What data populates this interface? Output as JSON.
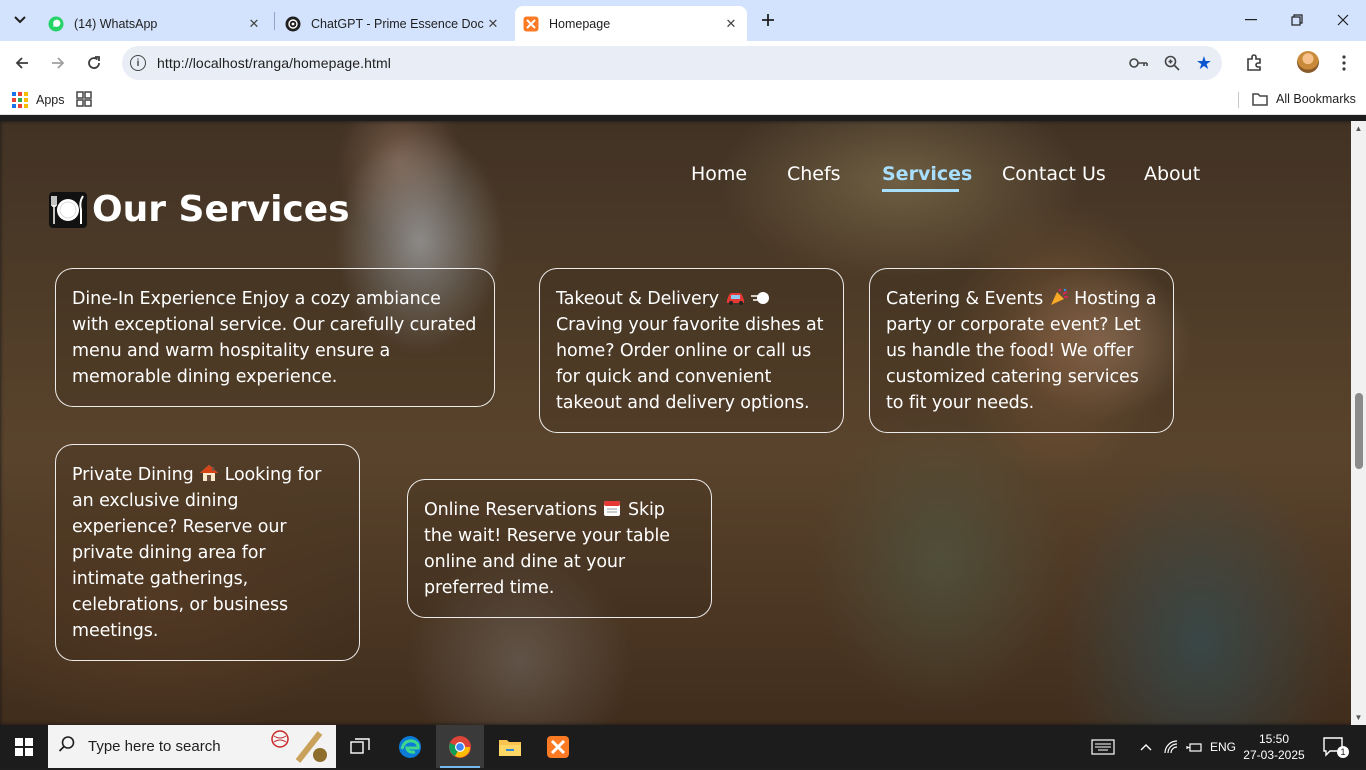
{
  "browser": {
    "tabs": [
      {
        "title": "(14) WhatsApp",
        "icon": "whatsapp-icon",
        "active": false
      },
      {
        "title": "ChatGPT - Prime Essence Doc",
        "icon": "chatgpt-icon",
        "active": false
      },
      {
        "title": "Homepage",
        "icon": "xampp-icon",
        "active": true
      }
    ],
    "url": "http://localhost/ranga/homepage.html",
    "bookmarks": {
      "apps_label": "Apps",
      "all_bookmarks_label": "All Bookmarks"
    }
  },
  "page": {
    "nav": [
      {
        "label": "Home",
        "active": false
      },
      {
        "label": "Chefs",
        "active": false
      },
      {
        "label": "Services",
        "active": true
      },
      {
        "label": "Contact Us",
        "active": false
      },
      {
        "label": "About",
        "active": false
      }
    ],
    "section_title": "Our Services",
    "services": [
      {
        "text": "Dine-In Experience Enjoy a cozy ambiance with exceptional service. Our carefully curated menu and warm hospitality ensure a memorable dining experience."
      },
      {
        "title": "Takeout & Delivery",
        "emoji": "car-icon",
        "text": "Craving your favorite dishes at home? Order online or call us for quick and convenient takeout and delivery options."
      },
      {
        "title": "Catering & Events",
        "emoji": "party-popper-icon",
        "text": "Hosting a party or corporate event? Let us handle the food! We offer customized catering services to fit your needs."
      },
      {
        "title": "Private Dining",
        "emoji": "house-icon",
        "text": "Looking for an exclusive dining experience? Reserve our private dining area for intimate gatherings, celebrations, or business meetings."
      },
      {
        "title": "Online Reservations",
        "emoji": "calendar-icon",
        "text": "Skip the wait! Reserve your table online and dine at your preferred time."
      }
    ]
  },
  "taskbar": {
    "search_placeholder": "Type here to search",
    "language": "ENG",
    "time": "15:50",
    "date": "27-03-2025",
    "notification_count": "1"
  },
  "colors": {
    "nav_active": "#a8dfff",
    "tabbar_bg": "#d3e3fd",
    "card_border": "#ffffff"
  }
}
